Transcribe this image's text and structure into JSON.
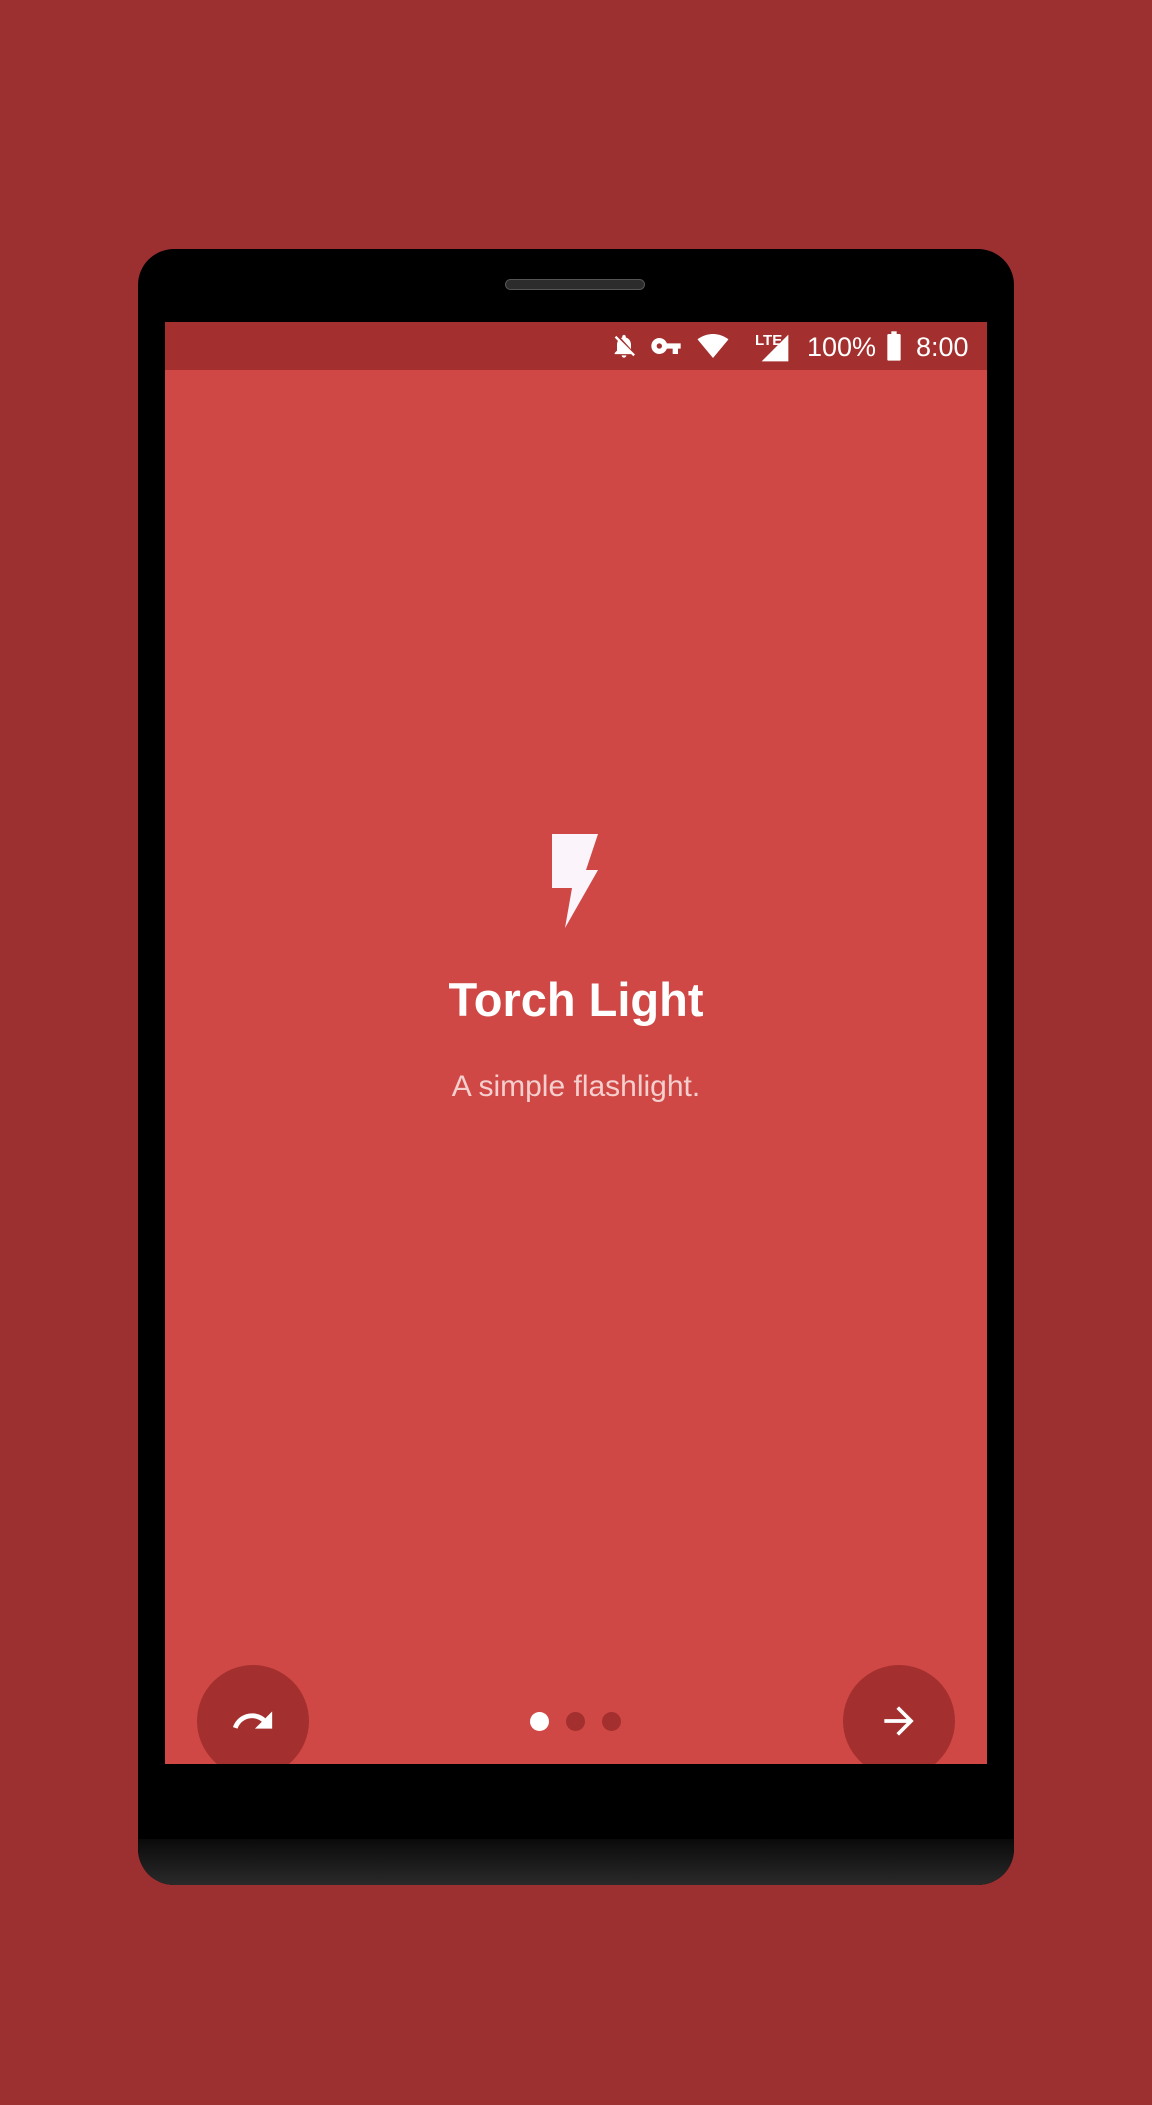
{
  "status_bar": {
    "battery_percent": "100%",
    "time": "8:00",
    "network_label": "LTE",
    "icons": [
      "notifications-off-icon",
      "vpn-key-icon",
      "wifi-icon",
      "cell-signal-icon",
      "battery-icon"
    ]
  },
  "onboarding": {
    "app_icon": "flash-bolt-icon",
    "title": "Torch Light",
    "subtitle": "A simple flashlight.",
    "page_count": 3,
    "current_page": 1,
    "skip_icon": "redo-icon",
    "next_icon": "arrow-forward-icon"
  },
  "colors": {
    "background": "#9c2f2f",
    "screen": "#cf4845",
    "status_bar": "#a3302e",
    "fab": "#a3302e",
    "text": "#ffffff"
  }
}
